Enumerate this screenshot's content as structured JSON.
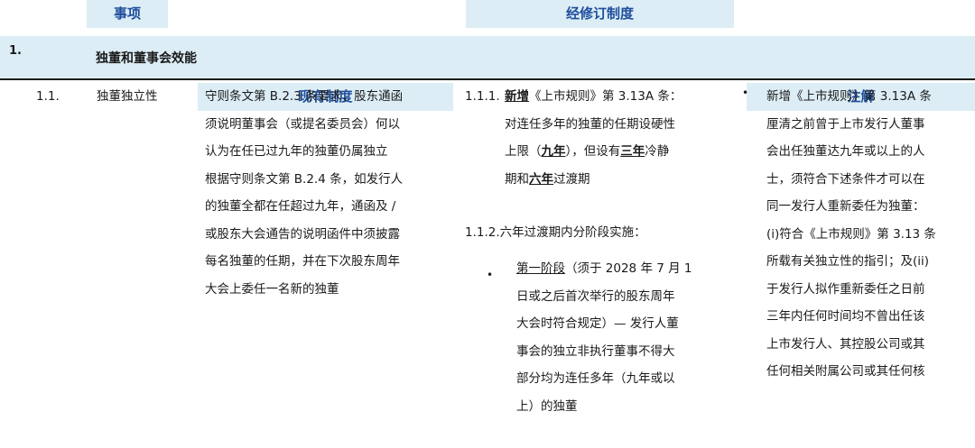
{
  "header": {
    "item": "事项",
    "current": "现有制度",
    "revised": "经修订制度",
    "notes": "注解"
  },
  "section": {
    "number": "1.",
    "title": "独董和董事会效能"
  },
  "row": {
    "number": "1.1.",
    "item": "独董独立性",
    "current_lines": [
      "守则条文第 B.2.3 条要求，股东通函",
      "须说明董事会（或提名委员会）何以",
      "认为在任已过九年的独董仍属独立",
      "根据守则条文第 B.2.4 条，如发行人",
      "的独董全都在任超过九年，通函及 /",
      "或股东大会通告的说明函件中须披露",
      "每名独董的任期，并在下次股东周年",
      "大会上委任一名新的独董"
    ],
    "revised": {
      "p1_number": "1.1.1.",
      "p1_lead_bold": "新增",
      "p1_line1_rest": "《上市规则》第 3.13A 条：",
      "p1_line2": "对连任多年的独董的任期设硬性",
      "p1_line3_a": "上限（",
      "p1_line3_b_bold": "九年",
      "p1_line3_c": "），但设有",
      "p1_line3_d_bold": "三年",
      "p1_line3_e": "冷静",
      "p1_line4_a": "期和",
      "p1_line4_b_bold": "六年",
      "p1_line4_c": "过渡期",
      "p2_line": "1.1.2.六年过渡期内分阶段实施：",
      "bullet_symbol": "•",
      "b_line1_ul": "第一阶段",
      "b_line1_rest": "（须于 2028 年 7 月 1",
      "b_lines": [
        "日或之后首次举行的股东周年",
        "大会时符合规定）—  发行人董",
        "事会的独立非执行董事不得大",
        "部分均为连任多年（九年或以",
        "上）的独董"
      ]
    },
    "notes": {
      "bullet_symbol": "•",
      "lines": [
        "新增《上市规则》第 3.13A 条",
        "厘清之前曾于上市发行人董事",
        "会出任独董达九年或以上的人",
        "士，须符合下述条件才可以在",
        "同一发行人重新委任为独董：",
        "(i)符合《上市规则》第 3.13 条",
        "所载有关独立性的指引；及(ii)",
        "于发行人拟作重新委任之日前",
        "三年内任何时间均不曾出任该",
        "上市发行人、其控股公司或其",
        "任何相关附属公司或其任何核"
      ]
    }
  }
}
